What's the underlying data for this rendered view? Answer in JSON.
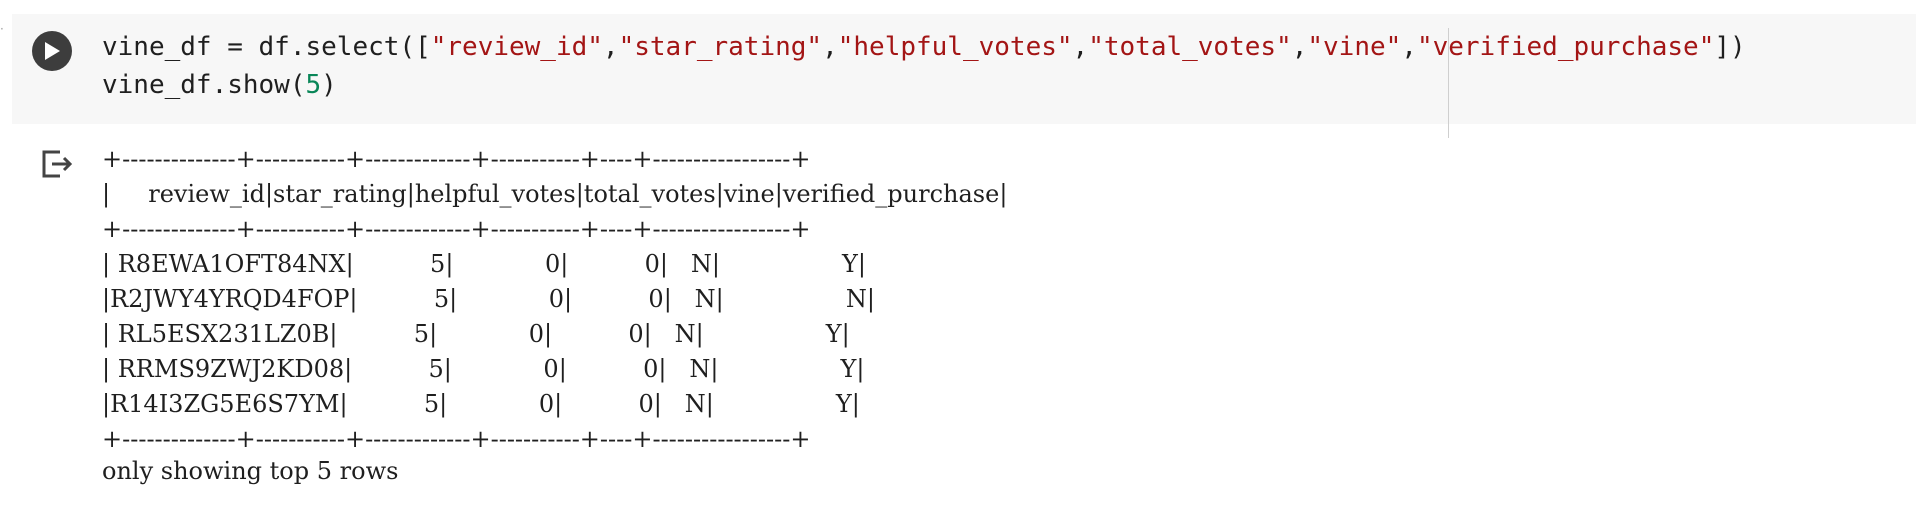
{
  "cell": {
    "code_lines": [
      [
        {
          "text": "vine_df = df.select([",
          "cls": ""
        },
        {
          "text": "\"review_id\"",
          "cls": "str"
        },
        {
          "text": ",",
          "cls": ""
        },
        {
          "text": "\"star_rating\"",
          "cls": "str"
        },
        {
          "text": ",",
          "cls": ""
        },
        {
          "text": "\"helpful_votes\"",
          "cls": "str"
        },
        {
          "text": ",",
          "cls": ""
        },
        {
          "text": "\"total_votes\"",
          "cls": "str"
        },
        {
          "text": ",",
          "cls": ""
        },
        {
          "text": "\"vine\"",
          "cls": "str"
        },
        {
          "text": ",",
          "cls": ""
        },
        {
          "text": "\"verified_purchase\"",
          "cls": "str"
        },
        {
          "text": "])",
          "cls": ""
        }
      ],
      [
        {
          "text": "vine_df.show(",
          "cls": ""
        },
        {
          "text": "5",
          "cls": "num"
        },
        {
          "text": ")",
          "cls": ""
        }
      ]
    ]
  },
  "output": {
    "table": {
      "columns": [
        "review_id",
        "star_rating",
        "helpful_votes",
        "total_votes",
        "vine",
        "verified_purchase"
      ],
      "widths": [
        14,
        11,
        13,
        11,
        4,
        17
      ],
      "rows": [
        [
          "R8EWA1OFT84NX",
          "5",
          "0",
          "0",
          "N",
          "Y"
        ],
        [
          "R2JWY4YRQD4FOP",
          "5",
          "0",
          "0",
          "N",
          "N"
        ],
        [
          "RL5ESX231LZ0B",
          "5",
          "0",
          "0",
          "N",
          "Y"
        ],
        [
          "RRMS9ZWJ2KD08",
          "5",
          "0",
          "0",
          "N",
          "Y"
        ],
        [
          "R14I3ZG5E6S7YM",
          "5",
          "0",
          "0",
          "N",
          "Y"
        ]
      ]
    },
    "footer": "only showing top 5 rows"
  },
  "icons": {
    "run": "play-icon",
    "output": "output-redirect-icon"
  },
  "colors": {
    "cell_background": "#f7f7f7",
    "run_button": "#3d3d3d",
    "string": "#a31515",
    "number": "#098658"
  }
}
